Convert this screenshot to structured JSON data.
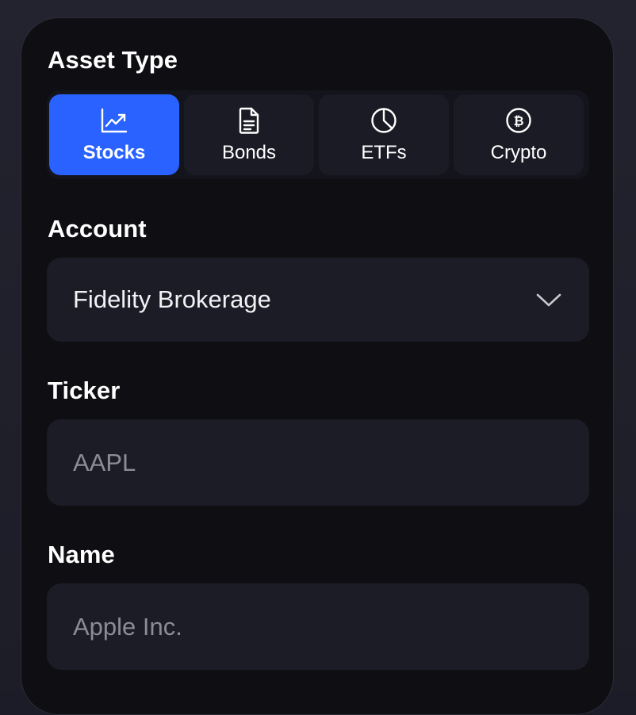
{
  "asset_type": {
    "label": "Asset Type",
    "options": [
      {
        "label": "Stocks",
        "icon": "trending-up-chart-icon",
        "selected": true
      },
      {
        "label": "Bonds",
        "icon": "document-icon",
        "selected": false
      },
      {
        "label": "ETFs",
        "icon": "pie-chart-icon",
        "selected": false
      },
      {
        "label": "Crypto",
        "icon": "bitcoin-icon",
        "selected": false
      }
    ]
  },
  "account": {
    "label": "Account",
    "selected_value": "Fidelity Brokerage"
  },
  "ticker": {
    "label": "Ticker",
    "placeholder": "AAPL"
  },
  "name": {
    "label": "Name",
    "placeholder": "Apple Inc."
  },
  "colors": {
    "accent": "#2962ff",
    "card_background": "#0e0e13",
    "field_background": "#1c1c27",
    "placeholder_text": "#8c8c96"
  }
}
